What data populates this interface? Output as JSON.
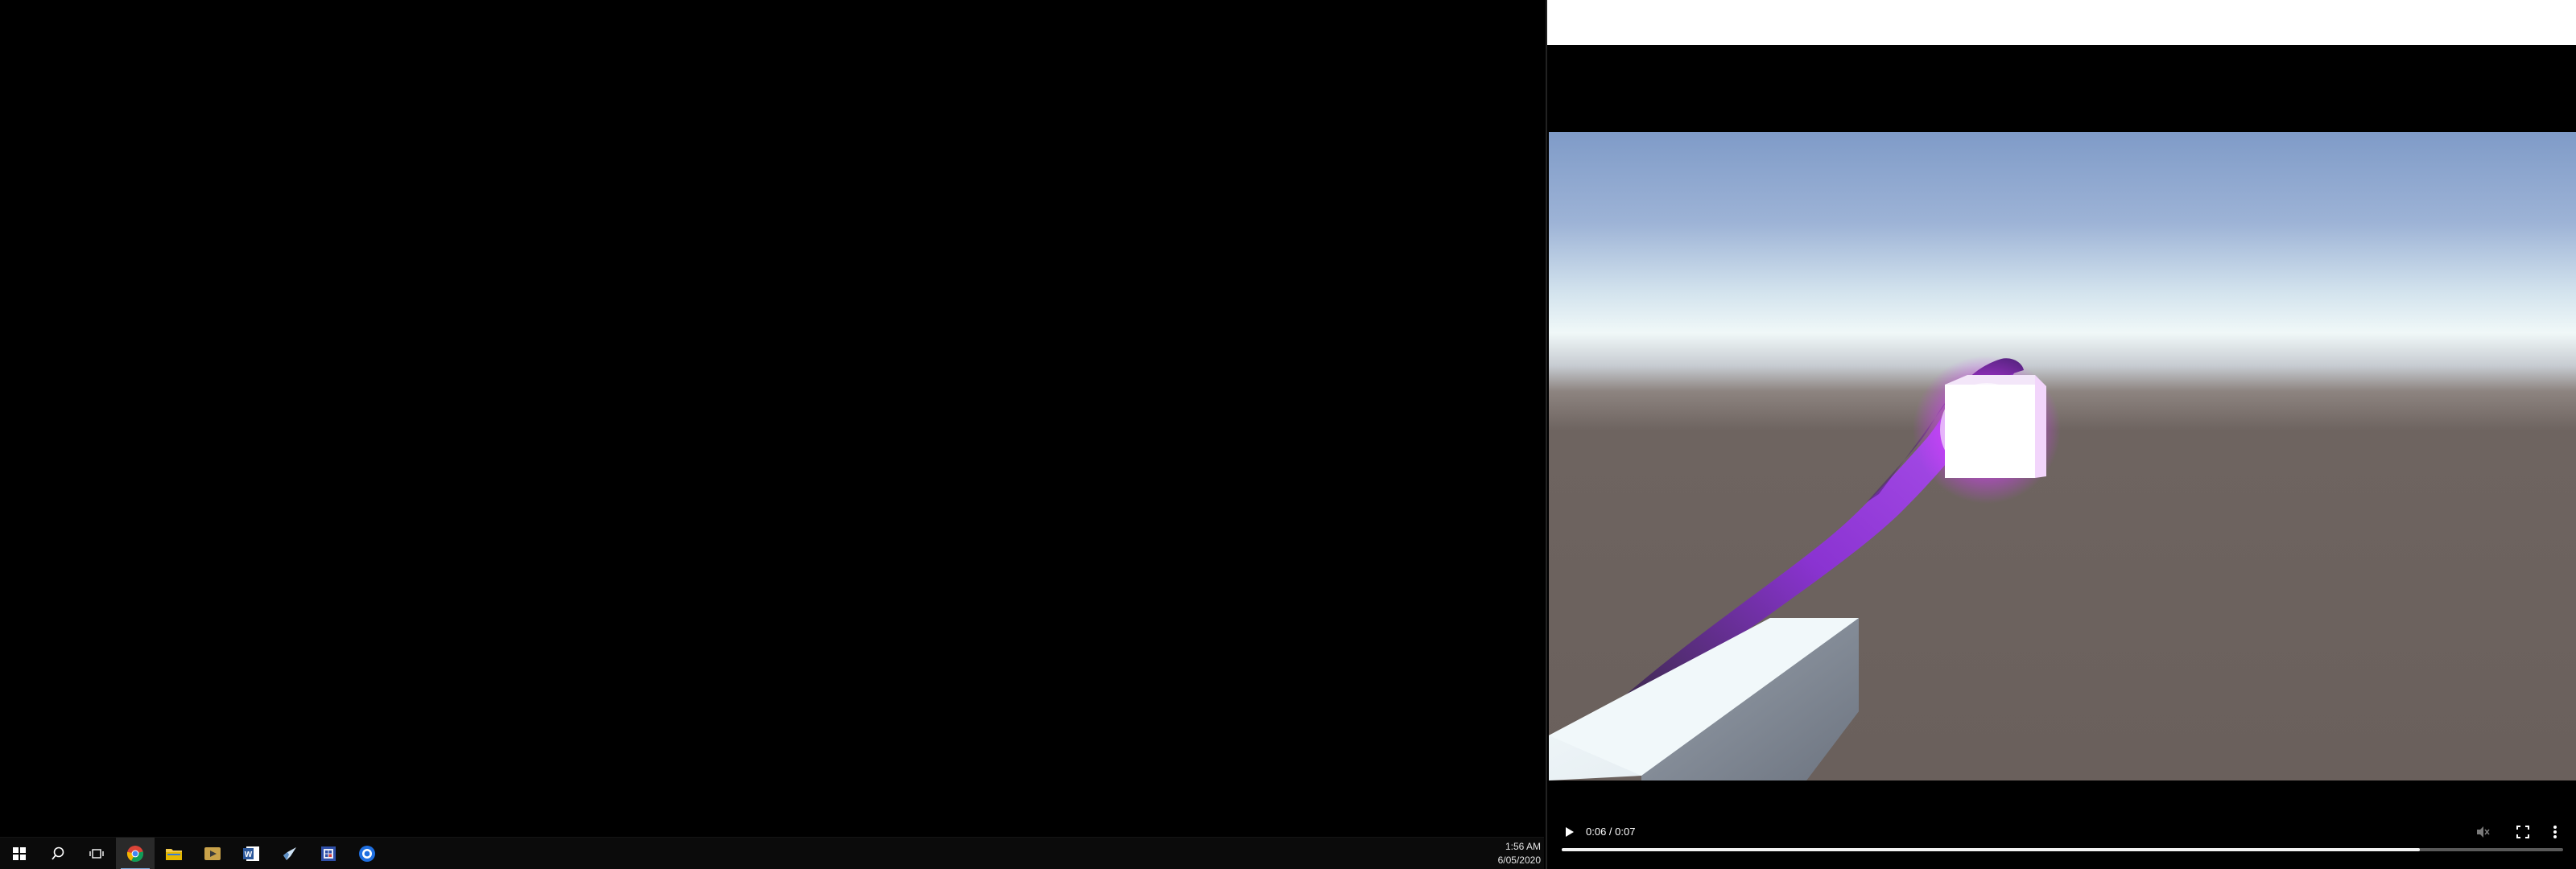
{
  "taskbar": {
    "clock": {
      "time": "1:56 AM",
      "date": "6/05/2020"
    },
    "apps": [
      {
        "name": "start",
        "icon": "windows-logo-icon"
      },
      {
        "name": "search",
        "icon": "search-icon"
      },
      {
        "name": "task-view",
        "icon": "task-view-icon"
      },
      {
        "name": "chrome",
        "icon": "chrome-icon",
        "active": true
      },
      {
        "name": "file-explorer",
        "icon": "folder-icon"
      },
      {
        "name": "media-player",
        "icon": "media-player-icon"
      },
      {
        "name": "word",
        "icon": "word-icon"
      },
      {
        "name": "steam",
        "icon": "steam-icon"
      },
      {
        "name": "store",
        "icon": "store-icon"
      },
      {
        "name": "app",
        "icon": "blue-circle-app-icon"
      }
    ]
  },
  "video": {
    "time_display": "0:06 / 0:07",
    "progress": 0.857,
    "muted": true
  },
  "colors": {
    "glow": "#e24bff",
    "hand": "#8f3bd6",
    "ground": "#6a605c",
    "sky": "#8aa6d1"
  }
}
